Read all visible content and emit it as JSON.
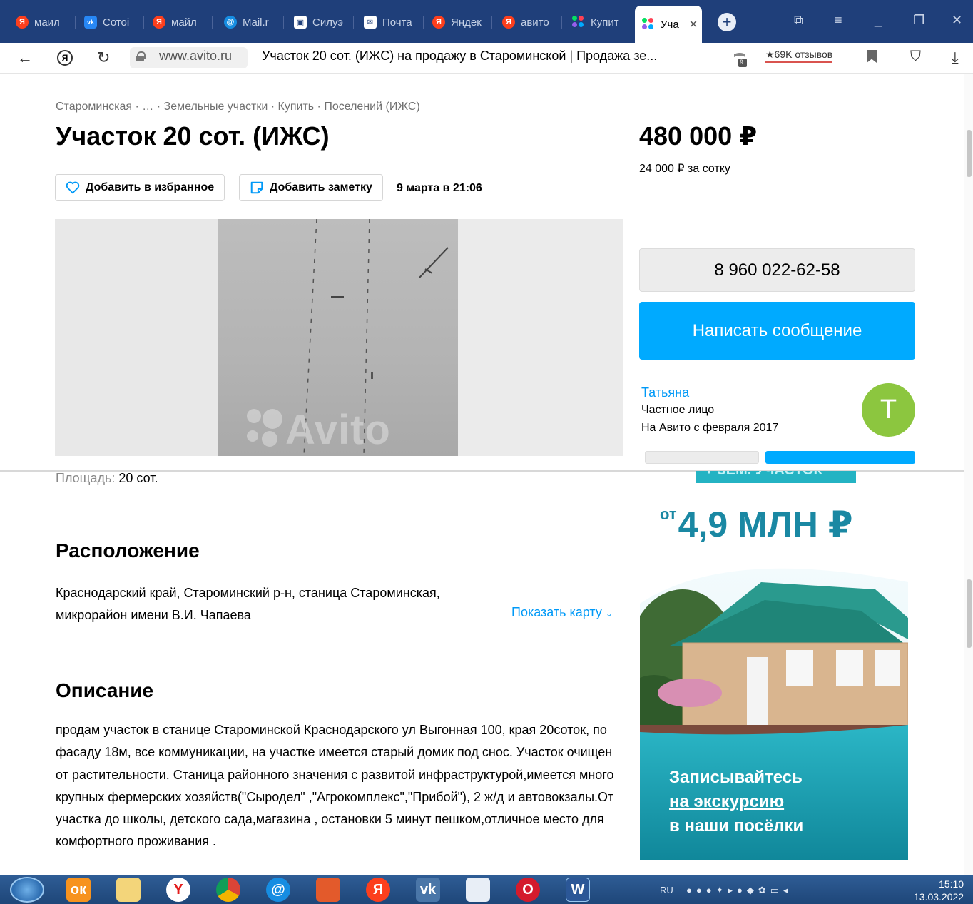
{
  "browser": {
    "tabs": [
      {
        "label": "маил",
        "icon": "yandex-icon"
      },
      {
        "label": "Сотоі",
        "icon": "vk-icon"
      },
      {
        "label": "майл",
        "icon": "yandex-icon"
      },
      {
        "label": "Mail.r",
        "icon": "mail-icon"
      },
      {
        "label": "Силуэ",
        "icon": "image-icon"
      },
      {
        "label": "Почта",
        "icon": "envelope-icon"
      },
      {
        "label": "Яндек",
        "icon": "yandex-icon"
      },
      {
        "label": "авито",
        "icon": "yandex-icon"
      },
      {
        "label": "Купит",
        "icon": "avito-icon"
      },
      {
        "label": "Уча",
        "icon": "avito-icon",
        "active": true
      }
    ],
    "address": {
      "domain": "www.avito.ru",
      "title": "Участок 20 сот. (ИЖС) на продажу в Староминской | Продажа зе...",
      "reviews": "★69K отзывов",
      "protect_badge": "9"
    }
  },
  "page": {
    "breadcrumb": "Староминская · … · Земельные участки · Купить · Поселений (ИЖС)",
    "title": "Участок 20 сот. (ИЖС)",
    "price": "480 000 ₽",
    "price_per": "24 000 ₽ за сотку",
    "favorite_label": "Добавить в избранное",
    "note_label": "Добавить заметку",
    "published": "9 марта в 21:06",
    "gallery_watermark": "Avito",
    "phone": "8 960 022-62-58",
    "message_label": "Написать сообщение",
    "seller": {
      "name": "Татьяна",
      "type": "Частное лицо",
      "since": "На Авито с февраля 2017",
      "avatar_letter": "T"
    },
    "area_label": "Площадь:",
    "area_value": "20 сот.",
    "location_heading": "Расположение",
    "address_line1": "Краснодарский край, Староминский р-н, станица Староминская,",
    "address_line2": "микрорайон имени В.И. Чапаева",
    "show_map": "Показать карту",
    "description_heading": "Описание",
    "description": "продам участок в станице Староминской Краснодарского ул Выгонная 100, края 20соток, по фасаду 18м, все коммуникации, на участке имеется старый домик под снос. Участок очищен от растительности. Станица районного значения с развитой инфраструктурой,имеется много крупных фермерских хозяйств(\"Сыродел\" ,\"Агрокомплекс\",\"Прибой\"), 2 ж/д и автовокзалы.От участка до школы, детского сада,магазина , остановки 5 минут пешком,отличное место для комфортного проживания ."
  },
  "ad": {
    "top_text": "+ ЗЕМ. УЧАСТОК",
    "price_prefix": "от",
    "price": "4,9 МЛН ₽",
    "line1": "Записывайтесь",
    "line2": "на экскурсию",
    "line3": "в наши посёлки"
  },
  "taskbar": {
    "lang": "RU",
    "time": "15:10",
    "date": "13.03.2022"
  },
  "colors": {
    "accent_blue": "#00aaff",
    "link_blue": "#0099f7",
    "avatar_green": "#8cc63f",
    "browser_tabbar": "#1f3f7a"
  }
}
